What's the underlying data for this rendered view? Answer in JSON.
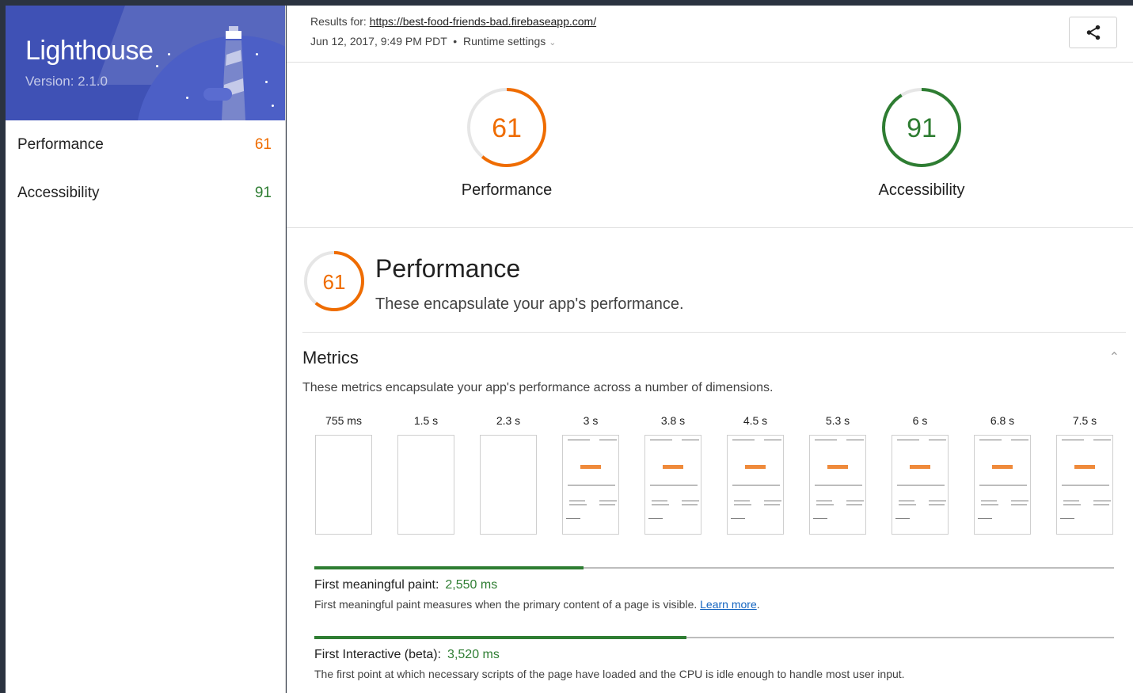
{
  "sidebar": {
    "brand": {
      "title": "Lighthouse",
      "version": "Version: 2.1.0"
    },
    "items": [
      {
        "label": "Performance",
        "score": "61"
      },
      {
        "label": "Accessibility",
        "score": "91"
      }
    ]
  },
  "header": {
    "results_prefix": "Results for:",
    "url": "https://best-food-friends-bad.firebaseapp.com/",
    "date": "Jun 12, 2017, 9:49 PM PDT",
    "separator": "•",
    "runtime_settings": "Runtime settings",
    "share_icon": "share-icon"
  },
  "gauges": [
    {
      "score": "61",
      "label": "Performance",
      "value": 61,
      "color": "#ef6c00"
    },
    {
      "score": "91",
      "label": "Accessibility",
      "value": 91,
      "color": "#2e7d32"
    }
  ],
  "performance_section": {
    "score": "61",
    "score_value": 61,
    "title": "Performance",
    "description": "These encapsulate your app's performance."
  },
  "metrics": {
    "title": "Metrics",
    "description": "These metrics encapsulate your app's performance across a number of dimensions.",
    "filmstrip": [
      "755 ms",
      "1.5 s",
      "2.3 s",
      "3 s",
      "3.8 s",
      "4.5 s",
      "5.3 s",
      "6 s",
      "6.8 s",
      "7.5 s"
    ],
    "items": [
      {
        "name": "First meaningful paint:",
        "value": "2,550 ms",
        "bar_fraction": 0.337,
        "description": "First meaningful paint measures when the primary content of a page is visible.",
        "link": "Learn more",
        "suffix": "."
      },
      {
        "name": "First Interactive (beta):",
        "value": "3,520 ms",
        "bar_fraction": 0.465,
        "description": "The first point at which necessary scripts of the page have loaded and the CPU is idle enough to handle most user input."
      }
    ]
  },
  "colors": {
    "accent": "#3f51b5",
    "average": "#ef6c00",
    "pass": "#2e7d32"
  }
}
